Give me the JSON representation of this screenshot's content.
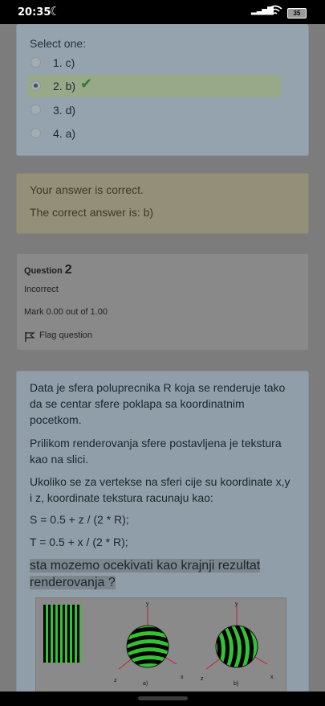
{
  "status_bar": {
    "time": "20:35",
    "moon_icon": "☾",
    "signal_icon": "▂▃▅▇",
    "wifi_icon": "wifi-icon",
    "battery": "35"
  },
  "answer_block": {
    "select_label": "Select one:",
    "options": [
      {
        "label": "1. c)",
        "checked": false,
        "correct": false
      },
      {
        "label": "2. b)",
        "checked": true,
        "correct": true
      },
      {
        "label": "3. d)",
        "checked": false,
        "correct": false
      },
      {
        "label": "4. a)",
        "checked": false,
        "correct": false
      }
    ],
    "check_mark": "✔"
  },
  "feedback": {
    "line1": "Your answer is correct.",
    "line2": "The correct answer is: b)"
  },
  "question_info": {
    "question_word": "Question",
    "number": "2",
    "state": "Incorrect",
    "mark": "Mark 0.00 out of 1.00",
    "flag_label": "Flag question"
  },
  "question": {
    "paragraphs": [
      "Data je sfera poluprecnika R koja se renderuje tako da se centar sfere poklapa sa koordinatnim pocetkom.",
      "Prilikom renderovanja sfere postavljena je tekstura kao na slici.",
      "Ukoliko se za vertekse na sferi cije su koordinate x,y i z, koordinate tekstura racunaju kao:",
      "S = 0.5 + z / (2 * R);",
      "T = 0.5 + x / (2 * R);",
      "sta mozemo ocekivati kao krajnji rezultat renderovanja ?"
    ]
  },
  "figure": {
    "label_a": "a)",
    "label_b": "b)",
    "axis_x": "x",
    "axis_y": "y",
    "axis_z": "z"
  },
  "colors": {
    "texture_green": "#32c332",
    "axis_red": "#c0203a",
    "correct_check": "#2e7a2e"
  }
}
